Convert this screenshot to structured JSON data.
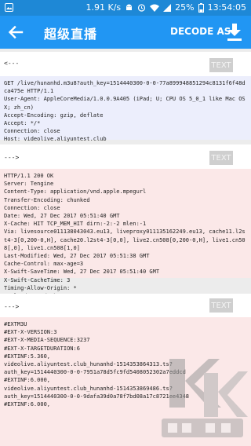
{
  "status": {
    "speed": "1.91 K/s",
    "battery": "25%",
    "time": "13:54:05"
  },
  "appbar": {
    "title": "超级直播",
    "decode_label": "DECODE AS"
  },
  "messages": [
    {
      "direction": "<---",
      "button": "TEXT",
      "content": "GET /live/hunanhd.m3u8?auth_key=1514440300-0-0-77a899948851294c8131f6f48dca475e HTTP/1.1\nUser-Agent: AppleCoreMedia/1.0.0.9A405 (iPad; U; CPU OS 5_0_1 like Mac OS X; zh_cn)\nAccept-Encoding: gzip, deflate\nAccept: */*\nConnection: close\nHost: videolive.aliyuntest.club"
    },
    {
      "direction": "--->",
      "button": "TEXT",
      "content": "HTTP/1.1 200 OK\nServer: Tengine\nContent-Type: application/vnd.apple.mpegurl\nTransfer-Encoding: chunked\nConnection: close\nDate: Wed, 27 Dec 2017 05:51:40 GMT\nX-Cache: HIT TCP_MEM_HIT dirn:-2:-2 mlen:-1\nVia: livesource011138043043.eu13, liveproxy011135162249.eu13, cache11.l2st4-3[0,200-0,H], cache20.l2st4-3[0,0], live2.cn508[0,200-0,H], live1.cn508[,0], live1.cn508[1,0]\nLast-Modified: Wed, 27 Dec 2017 05:51:38 GMT\nCache-Control: max-age=3\nX-Swift-SaveTime: Wed, 27 Dec 2017 05:51:40 GMT\nX-Swift-CacheTime: 3\nTiming-Allow-Origin: *\nEagleId: 79cd06ba15143539006275714e"
    },
    {
      "direction": "--->",
      "button": "TEXT",
      "content": "#EXTM3U\n#EXT-X-VERSION:3\n#EXT-X-MEDIA-SEQUENCE:3237\n#EXT-X-TARGETDURATION:6\n#EXTINF:5.360,\nvideolive.aliyuntest.club_hunanhd-1514353864313.ts?\nauth_key=1514440300-0-0-7951a78d5fc9fd5408052302a7eddcd\n#EXTINF:6.000,\nvideolive.aliyuntest.club_hunanhd-1514353869486.ts?\nauth_key=1514440300-0-0-9dafa39d0a78f7bd08a17c8721ee4348\n#EXTINF:6.000,"
    }
  ],
  "icons": {
    "back": "arrow-left-icon",
    "download": "download-icon",
    "watermark": "kk-download-watermark"
  },
  "colors": {
    "appbar": "#2196f3",
    "statusbar": "#1e88d6",
    "request_bg": "#eceefc",
    "response_bg": "#fbe8e8",
    "text_button": "#cfcfcf"
  }
}
